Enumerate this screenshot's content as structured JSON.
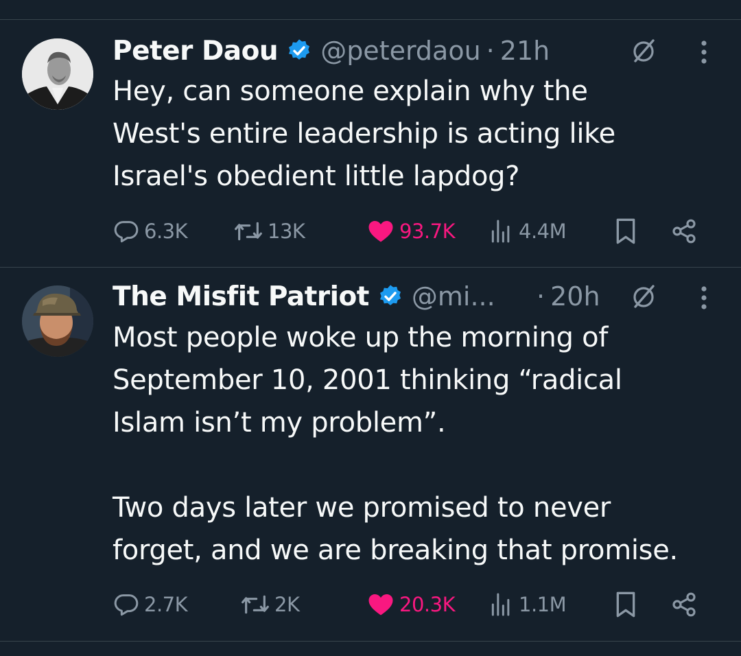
{
  "tweets": [
    {
      "author_name": "Peter Daou",
      "handle": "@peterdaou",
      "separator": "·",
      "time": "21h",
      "text": "Hey, can someone explain why the\nWest's entire leadership is acting like\nIsrael's obedient little lapdog?",
      "replies": "6.3K",
      "reposts": "13K",
      "likes": "93.7K",
      "views": "4.4M",
      "liked": true
    },
    {
      "author_name": "The Misfit Patriot",
      "handle": "@mi...",
      "separator": "·",
      "time": "20h",
      "text": "Most people woke up the morning of\nSeptember 10, 2001 thinking “radical\nIslam isn’t my problem”.\n\nTwo days later we promised to never\nforget, and we are breaking that promise.",
      "replies": "2.7K",
      "reposts": "2K",
      "likes": "20.3K",
      "views": "1.1M",
      "liked": true
    }
  ],
  "colors": {
    "background": "#15202b",
    "text": "#f7f9f9",
    "secondary": "#8b98a5",
    "verified": "#1d9bf0",
    "like": "#f91880",
    "divider": "#38444d"
  }
}
